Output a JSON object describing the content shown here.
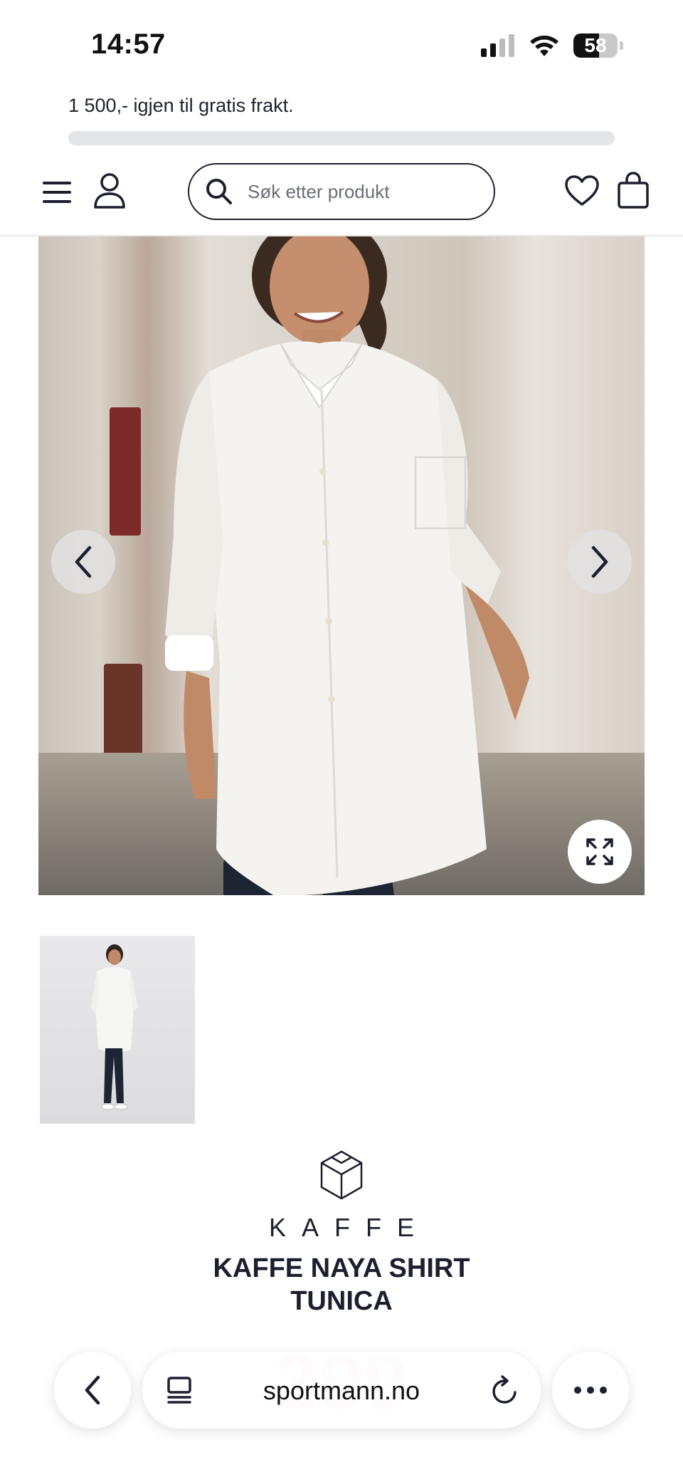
{
  "status_bar": {
    "time": "14:57",
    "battery_percent": "58",
    "battery_level": 0.58
  },
  "shipping": {
    "text": "1 500,- igjen til gratis frakt.",
    "progress": 0.0
  },
  "header": {
    "menu_icon": "hamburger-icon",
    "account_icon": "user-icon",
    "search_placeholder": "Søk etter produkt",
    "wishlist_icon": "heart-icon",
    "cart_icon": "shopping-bag-icon"
  },
  "gallery": {
    "prev_icon": "chevron-left-icon",
    "next_icon": "chevron-right-icon",
    "fullscreen_icon": "expand-icon"
  },
  "product": {
    "brand": "KAFFE",
    "title_line1": "KAFFE NAYA SHIRT",
    "title_line2": "TUNICA",
    "price_partial": "299"
  },
  "browser": {
    "url": "sportmann.no",
    "back_icon": "chevron-left-icon",
    "tabs_icon": "tabs-icon",
    "reload_icon": "reload-icon",
    "more_icon": "more-icon"
  },
  "colors": {
    "brand_navy": "#1c1f2e",
    "price_red": "#e0505a"
  }
}
